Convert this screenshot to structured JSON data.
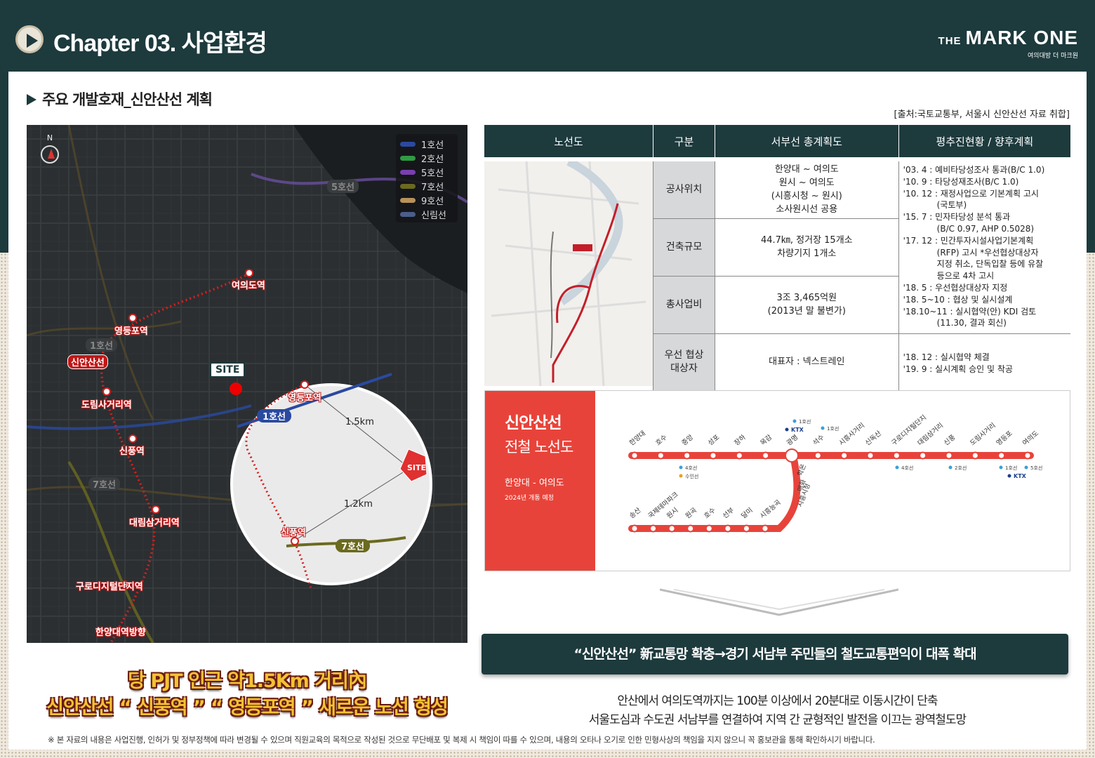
{
  "header": {
    "chapter_title": "Chapter 03. 사업환경",
    "logo_main": "MARK ONE",
    "logo_the": "THE",
    "logo_sub": "여의대방 더 마크원"
  },
  "section": {
    "title": "주요 개발호재_신안산선 계획",
    "source": "[출처:국토교통부, 서울시 신안산선 자료 취합]"
  },
  "map": {
    "north": "N",
    "legend": [
      {
        "label": "1호선",
        "color": "#2a4aa0"
      },
      {
        "label": "2호선",
        "color": "#2f9a44"
      },
      {
        "label": "5호선",
        "color": "#7a3fb0"
      },
      {
        "label": "7호선",
        "color": "#6b6a1f"
      },
      {
        "label": "9호선",
        "color": "#b8925a"
      },
      {
        "label": "신림선",
        "color": "#4a5e8c"
      }
    ],
    "stations": [
      "여의도역",
      "영등포역",
      "신안산선",
      "도림사거리역",
      "신풍역",
      "대림삼거리역",
      "구로디지털단지역",
      "한양대역방향"
    ],
    "line_labels": [
      "1호선",
      "7호선",
      "5호선"
    ],
    "site": "SITE",
    "zoom": {
      "station_top": "영등포역",
      "station_bottom": "신풍역",
      "line1": "1호선",
      "line7": "7호선",
      "dist1": "1.5km",
      "dist2": "1.2km",
      "site": "SITE"
    },
    "caption_line1": "당 PJT 인근 약1.5Km 거리內",
    "caption_line2": "신안산선 “ 신풍역 ” “ 영등포역 ” 새로운 노선 형성"
  },
  "table": {
    "headers": [
      "노선도",
      "구분",
      "서부선 총계획도",
      "평추진현황 / 향후계획"
    ],
    "rows": [
      {
        "label": "공사위치",
        "value": [
          "한양대 ~ 여의도",
          "원시 ~ 여의도",
          "(시흥시청 ~ 원시)",
          "소사원시선 공용"
        ]
      },
      {
        "label": "건축규모",
        "value": [
          "44.7㎞, 정거장 15개소",
          "차량기지 1개소"
        ]
      },
      {
        "label": "총사업비",
        "value": [
          "3조 3,465억원",
          "(2013년 말 불변가)"
        ]
      },
      {
        "label": "우선 협상대상자",
        "value": [
          "대표자 : 넥스트레인"
        ]
      }
    ],
    "history_top": [
      "'03. 4 : 예비타당성조사 통과(B/C 1.0)",
      "'10. 9 : 타당성재조사(B/C 1.0)",
      "'10. 12 : 재정사업으로 기본계획 고시",
      "(국토부)",
      "'15. 7 : 민자타당성 분석 통과",
      "(B/C 0.97, AHP 0.5028)",
      "'17. 12 : 민간투자시설사업기본계획",
      "(RFP) 고시 *우선협상대상자",
      "지정 취소, 단독입찰 등에 유찰",
      "등으로 4차 고시",
      "'18. 5 : 우선협상대상자 지정",
      "'18. 5~10 : 협상 및 실시설계",
      "'18.10~11 : 실시협약(안) KDI 검토",
      "(11.30, 결과 회신)"
    ],
    "history_bottom": [
      "'18. 12 : 실시협약 체결",
      "'19. 9 : 실시계획 승인 및 착공"
    ]
  },
  "line_diagram": {
    "title": "신안산선",
    "subtitle": "전철 노선도",
    "route": "한양대 - 여의도",
    "open": "2024년 개통 예정",
    "top_stations": [
      "한양대",
      "호수",
      "중앙",
      "성포",
      "장하",
      "목감",
      "광명",
      "석수",
      "시흥사거리",
      "신독산",
      "구로디지털단지",
      "대림삼거리",
      "신풍",
      "도림사거리",
      "영등포",
      "여의도"
    ],
    "branch_stations": [
      "학온",
      "매화",
      "시흥시청"
    ],
    "bottom_stations": [
      "송산",
      "국제테마파크",
      "원시",
      "원곡",
      "호수",
      "선부",
      "달미",
      "시흥능곡"
    ],
    "transfer_tags": [
      "1호선",
      "KTX",
      "1호선",
      "4호선",
      "수인선",
      "4호선",
      "2호선",
      "1호선",
      "5호선",
      "KTX"
    ]
  },
  "banner": "“신안산선” 新교통망 확충→경기 서남부 주민들의 철도교통편익이 대폭 확대",
  "description": [
    "안산에서 여의도역까지는 100분 이상에서 20분대로 이동시간이 단축",
    "서울도심과 수도권 서남부를 연결하여 지역 간 균형적인 발전을 이끄는 광역철도망"
  ],
  "footnote": "※ 본 자료의 내용은 사업진행, 인허가 및 정부정책에 따라 변경될 수 있으며 직원교육의 목적으로 작성된 것으로 무단배포 및 복제 시 책임이 따를 수 있으며, 내용의 오타나 오기로 인한 민형사상의 책임을 지지 않으니 꼭 홍보관을 통해 확인하시기 바랍니다."
}
